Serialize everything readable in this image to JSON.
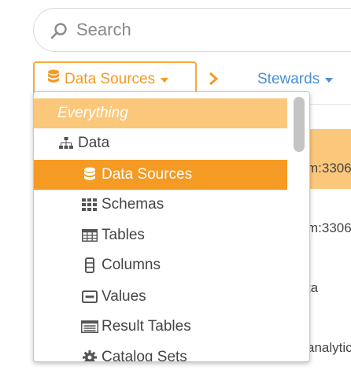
{
  "search": {
    "placeholder": "Search",
    "value": ""
  },
  "filter": {
    "label": "Data Sources"
  },
  "stewards": {
    "label": "Stewards"
  },
  "background_rows": [
    "m:3306",
    "m:3306",
    "ta",
    "analytic"
  ],
  "dropdown": {
    "items": [
      {
        "label": "Everything",
        "icon": "none",
        "level": 1,
        "state": "highlight"
      },
      {
        "label": "Data",
        "icon": "sitemap-icon",
        "level": 1,
        "state": "normal"
      },
      {
        "label": "Data Sources",
        "icon": "database-icon",
        "level": 2,
        "state": "selected"
      },
      {
        "label": "Schemas",
        "icon": "grid-icon",
        "level": 2,
        "state": "normal"
      },
      {
        "label": "Tables",
        "icon": "table-icon",
        "level": 2,
        "state": "normal"
      },
      {
        "label": "Columns",
        "icon": "column-icon",
        "level": 2,
        "state": "normal"
      },
      {
        "label": "Values",
        "icon": "value-icon",
        "level": 2,
        "state": "normal"
      },
      {
        "label": "Result Tables",
        "icon": "result-table-icon",
        "level": 2,
        "state": "normal"
      },
      {
        "label": "Catalog Sets",
        "icon": "gear-icon",
        "level": 2,
        "state": "normal"
      }
    ]
  },
  "colors": {
    "accent": "#f59a23",
    "accent_light": "#fbc77b",
    "link": "#4a90d9"
  }
}
